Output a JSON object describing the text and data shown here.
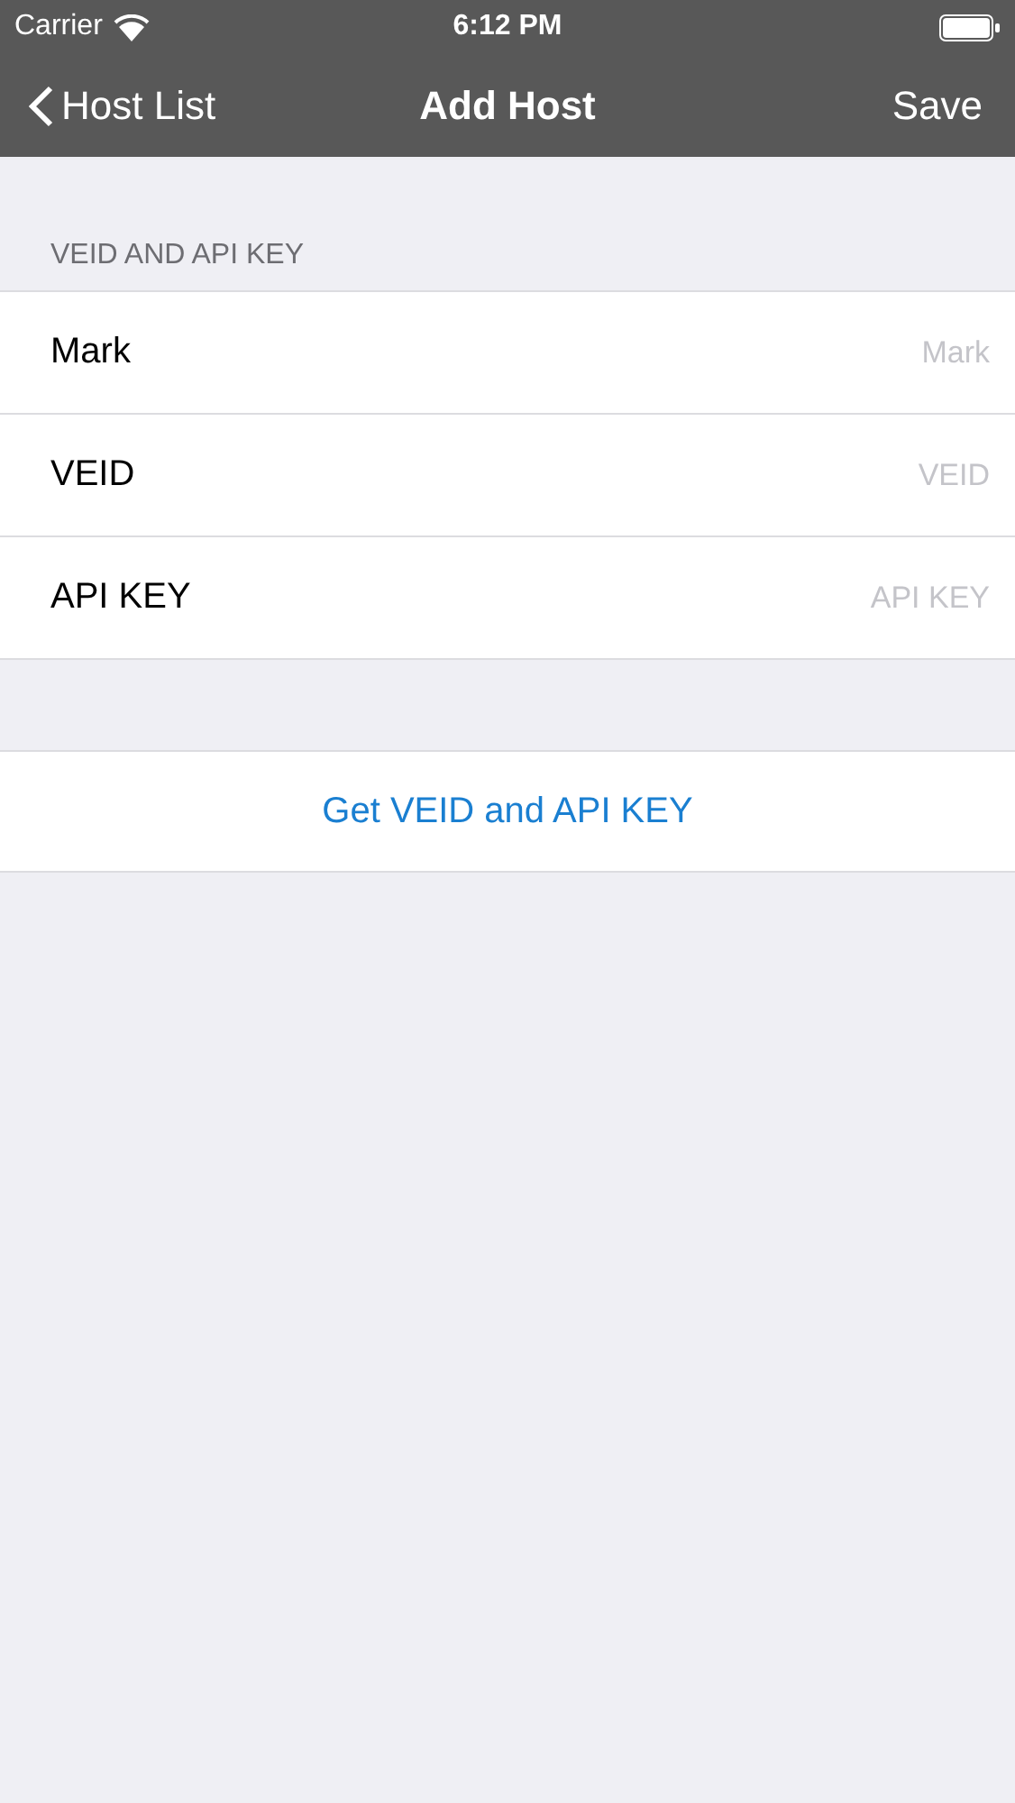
{
  "status_bar": {
    "carrier": "Carrier",
    "time": "6:12 PM"
  },
  "nav_bar": {
    "back_label": "Host List",
    "title": "Add Host",
    "action": "Save"
  },
  "section": {
    "header": "VEID AND API KEY",
    "fields": [
      {
        "label": "Mark",
        "placeholder": "Mark"
      },
      {
        "label": "VEID",
        "placeholder": "VEID"
      },
      {
        "label": "API KEY",
        "placeholder": "API KEY"
      }
    ]
  },
  "link_button": "Get VEID and API KEY"
}
